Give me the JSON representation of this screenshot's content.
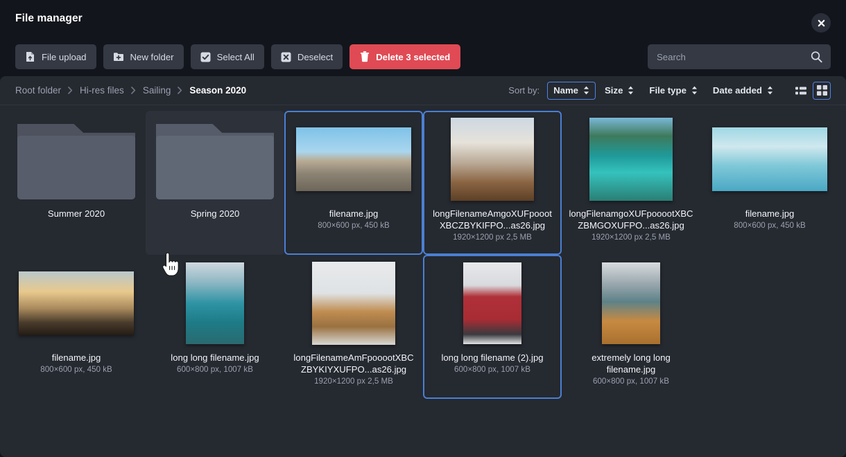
{
  "window": {
    "title": "File manager",
    "close_icon": "close-icon"
  },
  "toolbar": {
    "file_upload": "File upload",
    "new_folder": "New folder",
    "select_all": "Select All",
    "deselect": "Deselect",
    "delete": "Delete 3 selected",
    "delete_color": "#e04a54"
  },
  "search": {
    "placeholder": "Search",
    "value": "",
    "icon": "search-icon"
  },
  "breadcrumb": {
    "items": [
      {
        "label": "Root folder",
        "current": false
      },
      {
        "label": "Hi-res files",
        "current": false
      },
      {
        "label": "Sailing",
        "current": false
      },
      {
        "label": "Season 2020",
        "current": true
      }
    ]
  },
  "sort": {
    "label": "Sort by:",
    "options": [
      {
        "label": "Name",
        "active": true
      },
      {
        "label": "Size",
        "active": false
      },
      {
        "label": "File type",
        "active": false
      },
      {
        "label": "Date added",
        "active": false
      }
    ]
  },
  "view": {
    "list_label": "List view",
    "grid_label": "Grid view",
    "active": "grid",
    "accent": "#4a86e8"
  },
  "items": [
    {
      "type": "folder",
      "name": "Summer 2020",
      "meta": "",
      "selected": false,
      "hover": false
    },
    {
      "type": "folder",
      "name": "Spring 2020",
      "meta": "",
      "selected": false,
      "hover": true
    },
    {
      "type": "file",
      "name": "filename.jpg",
      "meta": "800×600 px,  450 kB",
      "selected": true,
      "hover": false,
      "thumb": "shipwreck-beach",
      "orient": "landscape"
    },
    {
      "type": "file",
      "name": "longFilenameAmgoXUFpoootXBCZBYKIFPO...as26.jpg",
      "meta": "1920×1200 px  2,5 MB",
      "selected": true,
      "hover": false,
      "thumb": "sailboat-deck",
      "orient": "square"
    },
    {
      "type": "file",
      "name": "longFilenamgoXUFpooootXBCZBMGOXUFPO...as26.jpg",
      "meta": "1920×1200 px  2,5 MB",
      "selected": false,
      "hover": false,
      "thumb": "cove-bay",
      "orient": "square"
    },
    {
      "type": "file",
      "name": "filename.jpg",
      "meta": "800×600 px,  450 kB",
      "selected": false,
      "hover": false,
      "thumb": "marina-aerial",
      "orient": "landscape"
    },
    {
      "type": "file",
      "name": "filename.jpg",
      "meta": "800×600 px,  450 kB",
      "selected": false,
      "hover": false,
      "thumb": "helm-sunset",
      "orient": "landscape"
    },
    {
      "type": "file",
      "name": "long long filename.jpg",
      "meta": "600×800 px,  1007 kB",
      "selected": false,
      "hover": false,
      "thumb": "island-aerial",
      "orient": "portrait"
    },
    {
      "type": "file",
      "name": "longFilenameAmFpooootXBCZBYKIYXUFPO...as26.jpg",
      "meta": "1920×1200 px  2,5 MB",
      "selected": false,
      "hover": false,
      "thumb": "dogs-boat",
      "orient": "square"
    },
    {
      "type": "file",
      "name": "long long filename (2).jpg",
      "meta": "600×800 px,  1007 kB",
      "selected": true,
      "hover": false,
      "thumb": "anchor-flag",
      "orient": "portrait"
    },
    {
      "type": "file",
      "name": "extremely long long filename.jpg",
      "meta": "600×800 px,  1007 kB",
      "selected": false,
      "hover": false,
      "thumb": "boat-mountains",
      "orient": "portrait"
    }
  ]
}
